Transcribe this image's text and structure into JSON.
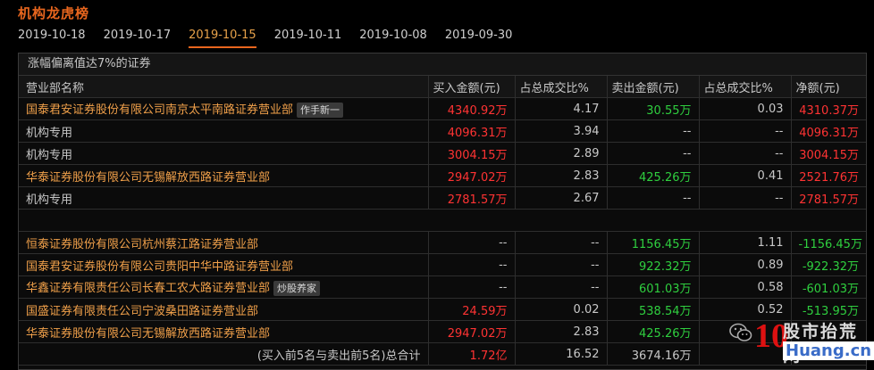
{
  "title": "机构龙虎榜",
  "dates": [
    "2019-10-18",
    "2019-10-17",
    "2019-10-15",
    "2019-10-11",
    "2019-10-08",
    "2019-09-30"
  ],
  "active_date_index": 2,
  "panel": {
    "caption": "涨幅偏离值达7%的证券",
    "headers": [
      "营业部名称",
      "买入金额(元)",
      "占总成交比%",
      "卖出金额(元)",
      "占总成交比%",
      "净额(元)"
    ],
    "buy_rows": [
      {
        "name": "国泰君安证券股份有限公司南京太平南路证券营业部",
        "tag": "作手新一",
        "buy": "4340.92万",
        "buy_pct": "4.17",
        "sell": "30.55万",
        "sell_pct": "0.03",
        "net": "4310.37万"
      },
      {
        "name": "机构专用",
        "tag": "",
        "buy": "4096.31万",
        "buy_pct": "3.94",
        "sell": "--",
        "sell_pct": "--",
        "net": "4096.31万"
      },
      {
        "name": "机构专用",
        "tag": "",
        "buy": "3004.15万",
        "buy_pct": "2.89",
        "sell": "--",
        "sell_pct": "--",
        "net": "3004.15万"
      },
      {
        "name": "华泰证券股份有限公司无锡解放西路证券营业部",
        "tag": "",
        "buy": "2947.02万",
        "buy_pct": "2.83",
        "sell": "425.26万",
        "sell_pct": "0.41",
        "net": "2521.76万"
      },
      {
        "name": "机构专用",
        "tag": "",
        "buy": "2781.57万",
        "buy_pct": "2.67",
        "sell": "--",
        "sell_pct": "--",
        "net": "2781.57万"
      }
    ],
    "sell_rows": [
      {
        "name": "恒泰证券股份有限公司杭州蔡江路证券营业部",
        "tag": "",
        "buy": "--",
        "buy_pct": "--",
        "sell": "1156.45万",
        "sell_pct": "1.11",
        "net": "-1156.45万"
      },
      {
        "name": "国泰君安证券股份有限公司贵阳中华中路证券营业部",
        "tag": "",
        "buy": "--",
        "buy_pct": "--",
        "sell": "922.32万",
        "sell_pct": "0.89",
        "net": "-922.32万"
      },
      {
        "name": "华鑫证券有限责任公司长春工农大路证券营业部",
        "tag": "炒股养家",
        "buy": "--",
        "buy_pct": "--",
        "sell": "601.03万",
        "sell_pct": "0.58",
        "net": "-601.03万"
      },
      {
        "name": "国盛证券有限责任公司宁波桑田路证券营业部",
        "tag": "",
        "buy": "24.59万",
        "buy_pct": "0.02",
        "sell": "538.54万",
        "sell_pct": "0.52",
        "net": "-513.95万"
      },
      {
        "name": "华泰证券股份有限公司无锡解放西路证券营业部",
        "tag": "",
        "buy": "2947.02万",
        "buy_pct": "2.83",
        "sell": "425.26万",
        "sell_pct": "",
        "net": ""
      }
    ],
    "total": {
      "name": "(买入前5名与卖出前5名)总合计",
      "buy": "1.72亿",
      "buy_pct": "16.52",
      "sell": "3674.16万"
    }
  },
  "watermark": {
    "brand": "股市抬荒网",
    "number": "10",
    "domain": "Huang.cn"
  }
}
